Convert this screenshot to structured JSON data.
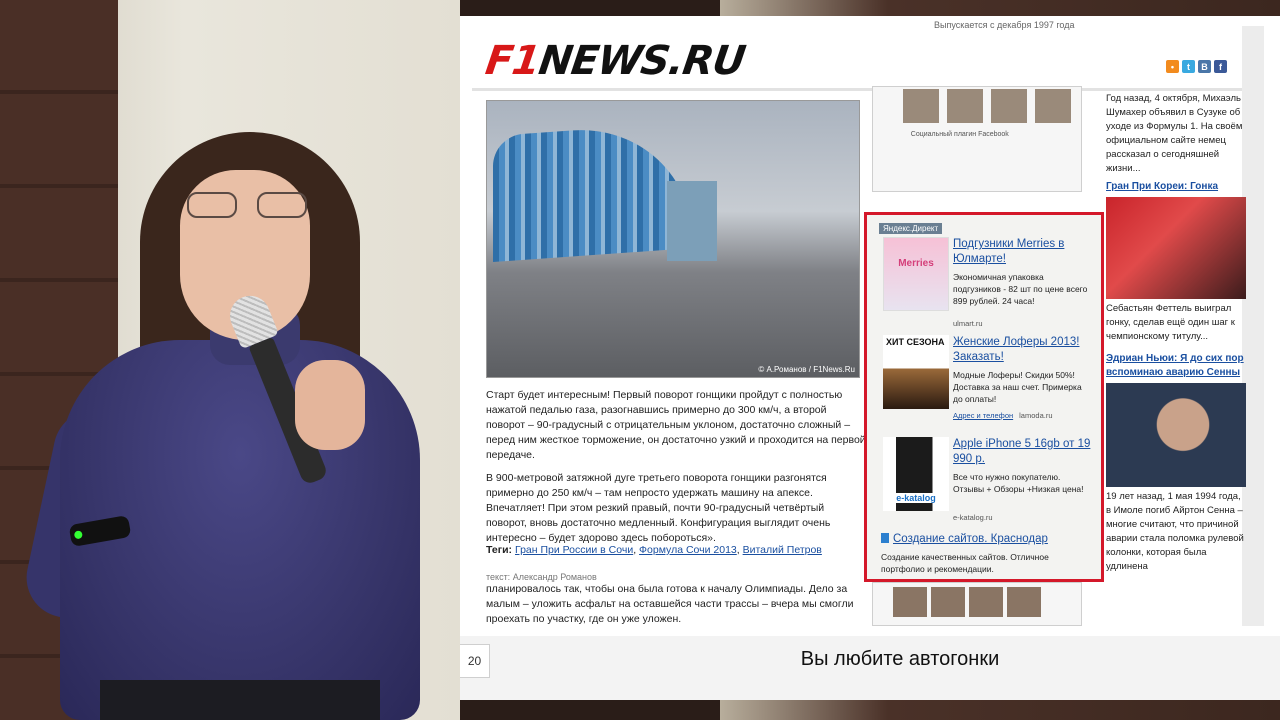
{
  "slide": {
    "number": "20",
    "caption": "Вы любите автогонки"
  },
  "site": {
    "tagline": "Выпускается с декабря 1997 года",
    "logo_main": "F1",
    "logo_rest": "NEWS.RU",
    "social_icons": [
      "rss-icon",
      "twitter-icon",
      "vkontakte-icon",
      "facebook-icon"
    ],
    "photo_credit": "© А.Романов / F1News.Ru",
    "article": {
      "p1": "Старт будет интересным! Первый поворот гонщики пройдут с полностью нажатой педалью газа, разогнавшись примерно до 300 км/ч, а второй поворот – 90-градусный с отрицательным уклоном, достаточно сложный – перед ним жесткое торможение, он достаточно узкий и проходится на первой передаче.",
      "p2": "В 900-метровой затяжной дуге третьего поворота гонщики разгонятся примерно до 250 км/ч – там непросто удержать машину на апексе. Впечатляет! При этом резкий правый, почти 90-градусный четвёртый поворот, вновь достаточно медленный. Конфигурация выглядит очень интересно – будет здорово здесь побороться».",
      "tags_label": "Теги:",
      "tags": [
        "Гран При России в Сочи",
        "Формула Сочи 2013",
        "Виталий Петров"
      ],
      "author": "текст: Александр Романов",
      "more": "планировалось так, чтобы она была готова к началу Олимпиады. Дело за малым – уложить асфальт на оставшейся части трассы – вчера мы смогли проехать по участку, где он уже уложен."
    },
    "fb_label": "Социальный плагин Facebook",
    "ads": {
      "header": "Яндекс.Директ",
      "items": [
        {
          "title": "Подгузники Merries в Юлмарте!",
          "desc": "Экономичная упаковка подгузников - 82 шт по цене всего 899 рублей. 24 часа!",
          "link": "",
          "src": "ulmart.ru"
        },
        {
          "title": "Женские Лоферы 2013! Заказать!",
          "desc": "Модные Лоферы! Скидки 50%! Доставка за наш счет. Примерка до оплаты!",
          "link": "Адрес и телефон",
          "src": "lamoda.ru"
        },
        {
          "title": "Apple iPhone 5 16gb от 19 990 р.",
          "desc": "Все что нужно покупателю. Отзывы + Обзоры +Низкая цена!",
          "link": "",
          "src": "e-katalog.ru"
        }
      ],
      "img_labels": [
        "Merries",
        "ХИТ СЕЗОНА",
        "e-katalog"
      ],
      "last_title": "Создание сайтов. Краснодар",
      "last_desc": "Создание качественных сайтов. Отличное портфолио и рекомендации."
    },
    "news": {
      "top_text": "Год назад, 4 октября, Михаэль Шумахер объявил в Сузуке об уходе из Формулы 1. На своём официальном сайте немец рассказал о сегодняшней жизни...",
      "head1": "Гран При Кореи: Гонка",
      "text1": "Себастьян Феттель выиграл гонку, сделав ещё один шаг к чемпионскому титулу...",
      "head2": "Эдриан Ньюи: Я до сих пор вспоминаю аварию Сенны",
      "text2": "19 лет назад, 1 мая 1994 года, в Имоле погиб Айртон Сенна – многие считают, что причиной аварии стала поломка рулевой колонки, которая была удлинена"
    }
  }
}
